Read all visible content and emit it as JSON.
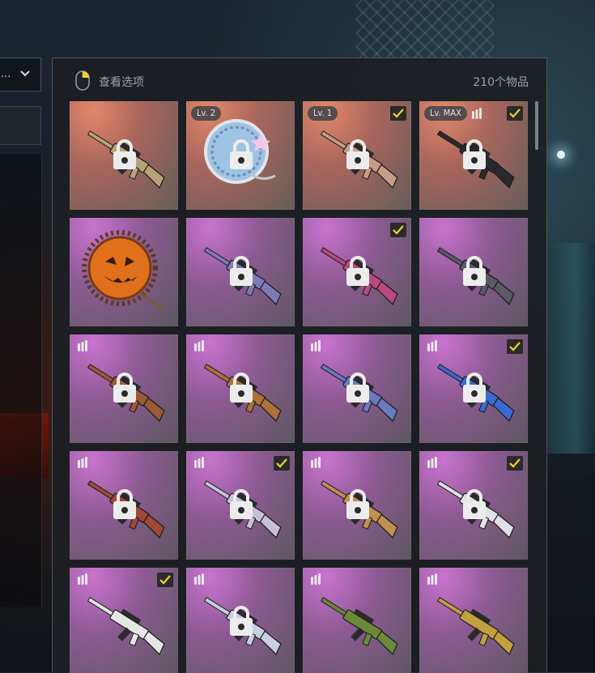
{
  "left_panel": {
    "dropdown_text": "..."
  },
  "panel": {
    "view_options_label": "查看选项",
    "item_count": "210个物品"
  },
  "colors": {
    "rarity_orange": "#e2876a",
    "rarity_purple": "#c973cf",
    "check_yellow": "#f2d22e",
    "panel_bg": "#1c1f23"
  },
  "items": [
    {
      "rarity": "orange",
      "type": "rifle",
      "skin_color": "#b8a27a",
      "locked": true,
      "checked": false,
      "level": "",
      "ammo_icon": false
    },
    {
      "rarity": "orange",
      "type": "badge",
      "skin_color": "#8fb4d8",
      "locked": true,
      "checked": false,
      "level": "Lv. 2",
      "ammo_icon": false
    },
    {
      "rarity": "orange",
      "type": "rifle",
      "skin_color": "#c79b86",
      "locked": true,
      "checked": true,
      "level": "Lv. 1",
      "ammo_icon": false
    },
    {
      "rarity": "orange",
      "type": "rifle",
      "skin_color": "#2a2a2e",
      "locked": true,
      "checked": true,
      "level": "Lv. MAX",
      "ammo_icon": true
    },
    {
      "rarity": "purple",
      "type": "pumpkin",
      "skin_color": "#e0701c",
      "locked": false,
      "checked": false,
      "level": "",
      "ammo_icon": false
    },
    {
      "rarity": "purple",
      "type": "rifle",
      "skin_color": "#7f7ab8",
      "locked": true,
      "checked": false,
      "level": "",
      "ammo_icon": false
    },
    {
      "rarity": "purple",
      "type": "rifle",
      "skin_color": "#b84a7e",
      "locked": true,
      "checked": true,
      "level": "",
      "ammo_icon": false
    },
    {
      "rarity": "purple",
      "type": "rifle",
      "skin_color": "#5a5a66",
      "locked": true,
      "checked": false,
      "level": "",
      "ammo_icon": false
    },
    {
      "rarity": "purple",
      "type": "rifle",
      "skin_color": "#9a5a38",
      "locked": true,
      "checked": false,
      "level": "",
      "ammo_icon": true
    },
    {
      "rarity": "purple",
      "type": "rifle",
      "skin_color": "#b0703a",
      "locked": true,
      "checked": false,
      "level": "",
      "ammo_icon": true
    },
    {
      "rarity": "purple",
      "type": "rifle",
      "skin_color": "#6a7ac0",
      "locked": true,
      "checked": false,
      "level": "",
      "ammo_icon": true
    },
    {
      "rarity": "purple",
      "type": "rifle",
      "skin_color": "#3a6ad0",
      "locked": true,
      "checked": true,
      "level": "",
      "ammo_icon": true
    },
    {
      "rarity": "purple",
      "type": "rifle",
      "skin_color": "#a04838",
      "locked": true,
      "checked": false,
      "level": "",
      "ammo_icon": true
    },
    {
      "rarity": "purple",
      "type": "rifle",
      "skin_color": "#c8c0d8",
      "locked": true,
      "checked": true,
      "level": "",
      "ammo_icon": true
    },
    {
      "rarity": "purple",
      "type": "rifle",
      "skin_color": "#c09050",
      "locked": true,
      "checked": false,
      "level": "",
      "ammo_icon": true
    },
    {
      "rarity": "purple",
      "type": "rifle",
      "skin_color": "#e0e0e6",
      "locked": true,
      "checked": true,
      "level": "",
      "ammo_icon": true
    },
    {
      "rarity": "purple",
      "type": "rifle",
      "skin_color": "#e6e6e6",
      "locked": false,
      "checked": true,
      "level": "",
      "ammo_icon": true
    },
    {
      "rarity": "purple",
      "type": "rifle",
      "skin_color": "#c8d0e0",
      "locked": true,
      "checked": false,
      "level": "",
      "ammo_icon": true
    },
    {
      "rarity": "purple",
      "type": "rifle",
      "skin_color": "#6a8a3a",
      "locked": false,
      "checked": false,
      "level": "",
      "ammo_icon": true
    },
    {
      "rarity": "purple",
      "type": "rifle",
      "skin_color": "#c0a040",
      "locked": false,
      "checked": false,
      "level": "",
      "ammo_icon": true
    }
  ]
}
